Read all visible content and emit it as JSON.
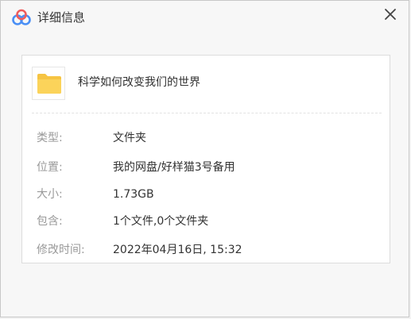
{
  "window": {
    "title": "详细信息",
    "app_icon": "baidu-netdisk-cloud-icon",
    "close_icon": "close-icon"
  },
  "file": {
    "icon": "folder-icon",
    "name": "科学如何改变我们的世界"
  },
  "details": [
    {
      "label": "类型:",
      "value": "文件夹"
    },
    {
      "label": "位置:",
      "value": "我的网盘/好样猫3号备用"
    },
    {
      "label": "大小:",
      "value": "1.73GB"
    },
    {
      "label": "包含:",
      "value": "1个文件,0个文件夹"
    },
    {
      "label": "修改时间:",
      "value": "2022年04月16日, 15:32"
    }
  ],
  "colors": {
    "folder": "#f6c443",
    "logo_blue": "#4a8ff5",
    "logo_red": "#ef5b5b",
    "label_gray": "#999999",
    "text": "#333333"
  }
}
